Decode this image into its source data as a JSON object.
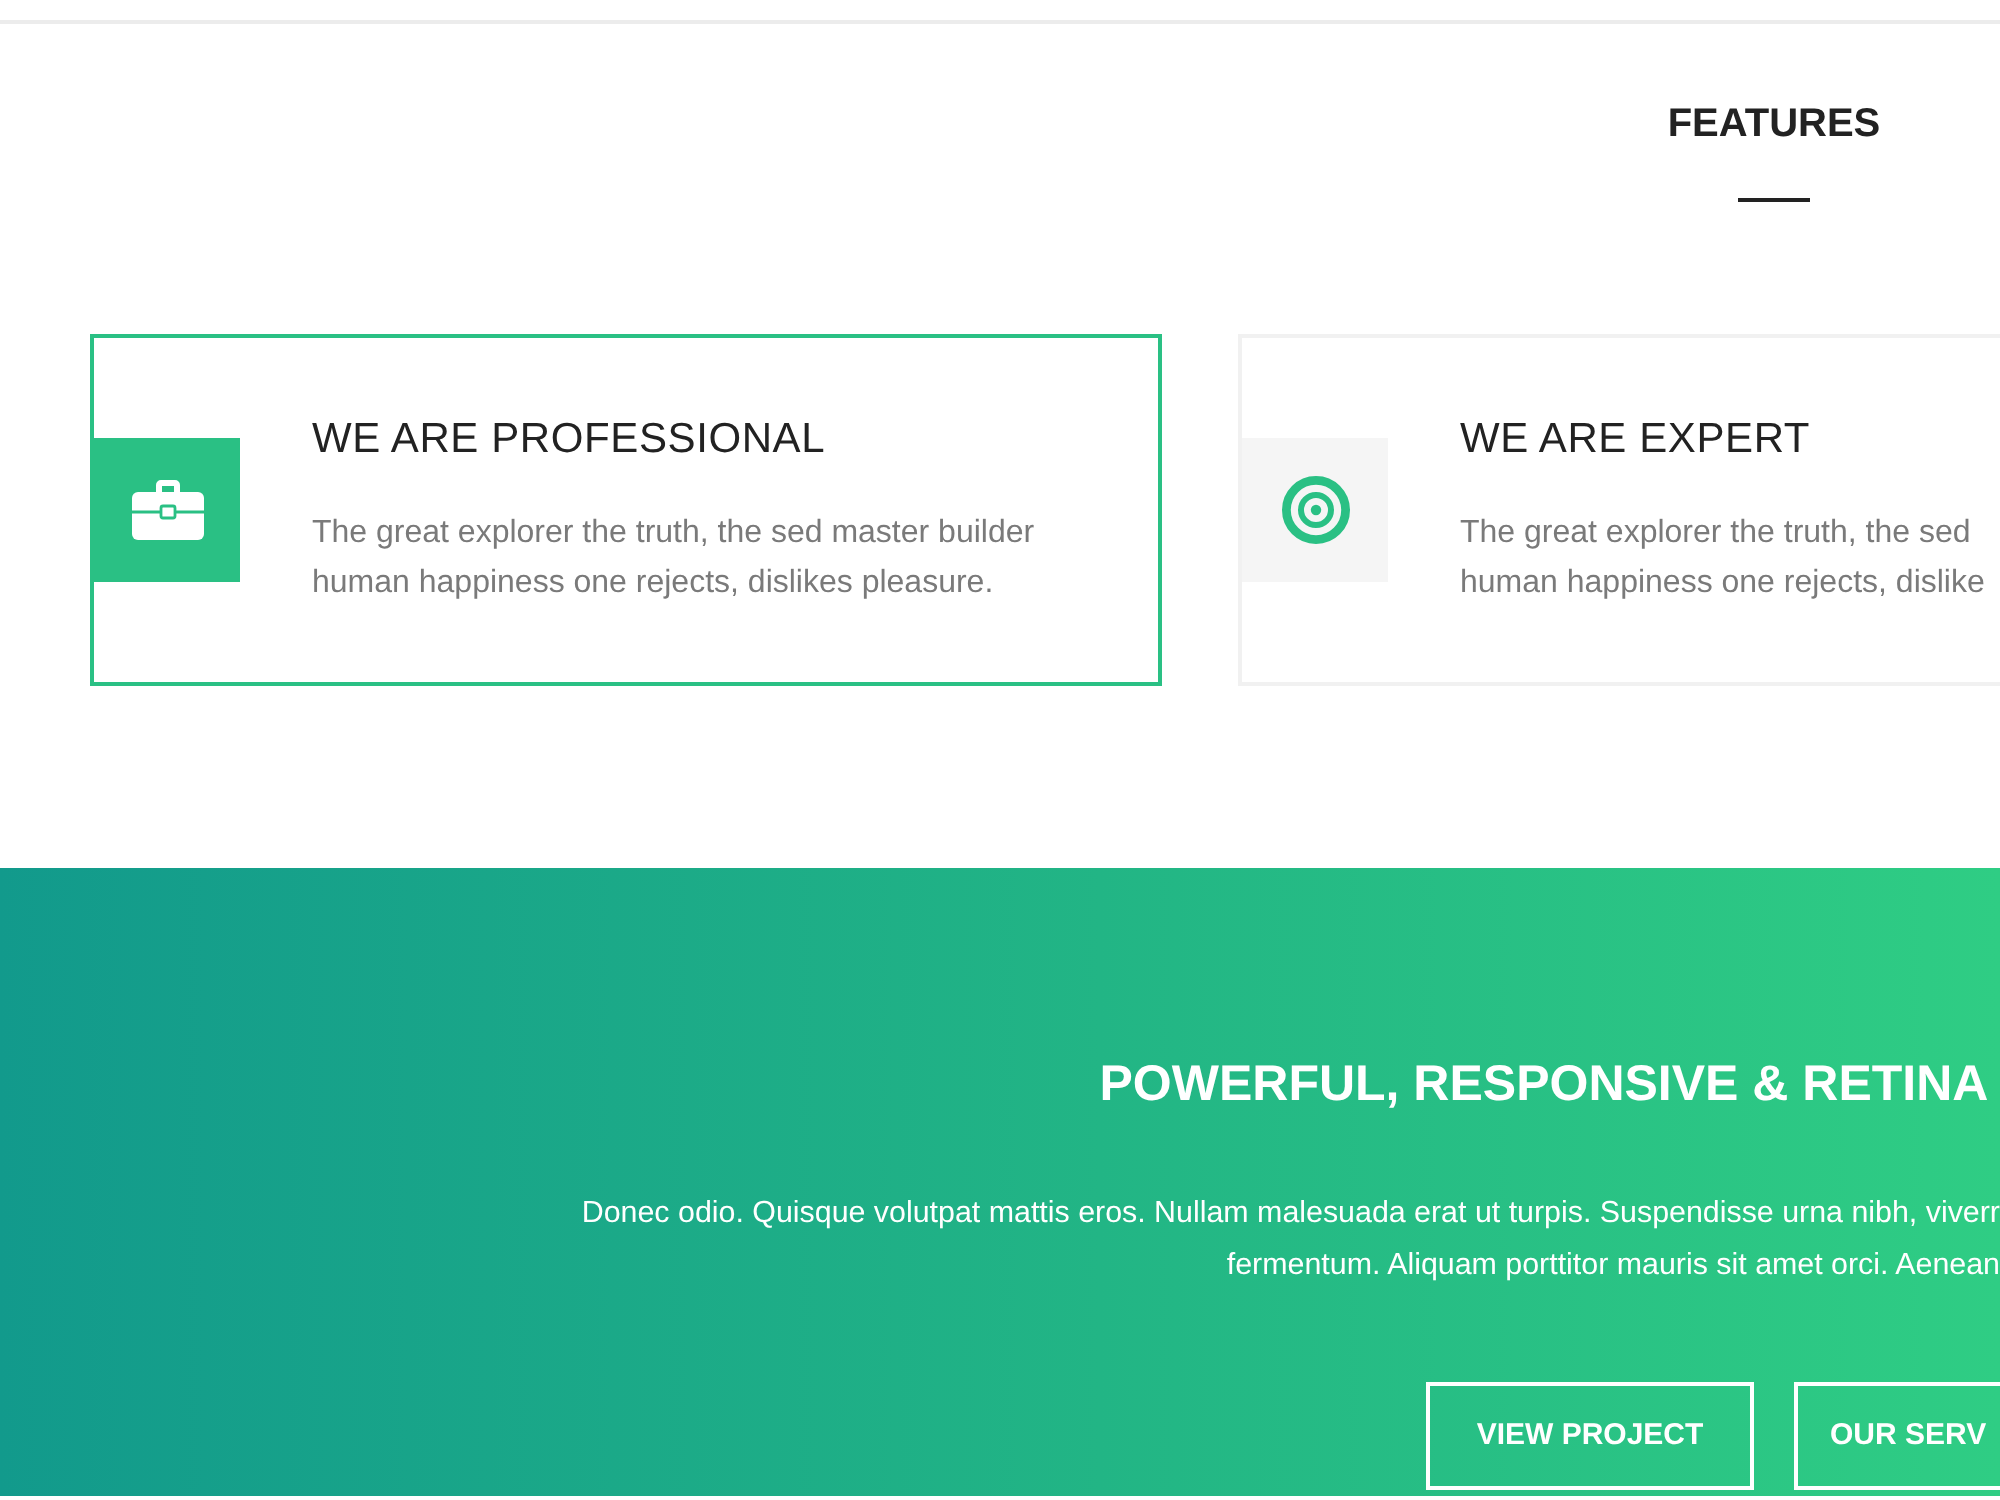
{
  "features_section": {
    "title": "FEATURES"
  },
  "features": [
    {
      "title": "WE ARE PROFESSIONAL",
      "description": "The great explorer the truth, the sed master builder\nhuman happiness one rejects, dislikes pleasure.",
      "selected": true
    },
    {
      "title": "WE ARE EXPERT",
      "description": "The great explorer the truth, the sed\nhuman happiness one rejects, dislike",
      "selected": false
    }
  ],
  "hero": {
    "title": "POWERFUL, RESPONSIVE & RETINA",
    "text": "Donec odio. Quisque volutpat mattis eros. Nullam malesuada erat ut turpis. Suspendisse urna nibh, viverr\nfermentum. Aliquam porttitor mauris sit amet orci. Aenean",
    "buttons": [
      "VIEW PROJECT",
      "OUR SERV"
    ]
  }
}
